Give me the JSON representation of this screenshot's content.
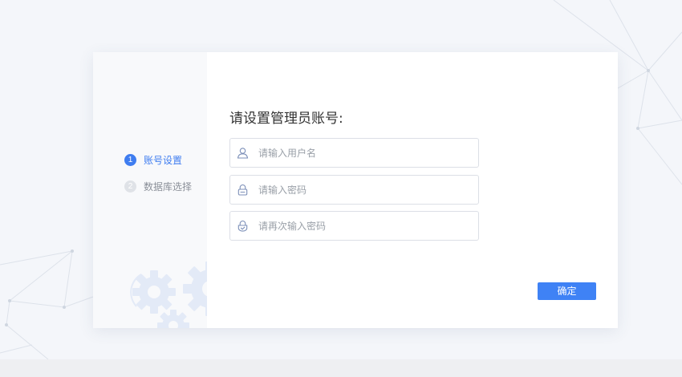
{
  "sidebar": {
    "steps": [
      {
        "number": "1",
        "label": "账号设置",
        "state": "active"
      },
      {
        "number": "2",
        "label": "数据库选择",
        "state": "pending"
      }
    ],
    "decoration_icon": "gears-icon"
  },
  "form": {
    "title": "请设置管理员账号:",
    "fields": [
      {
        "icon": "user-icon",
        "placeholder": "请输入用户名",
        "value": ""
      },
      {
        "icon": "lock-icon",
        "placeholder": "请输入密码",
        "value": ""
      },
      {
        "icon": "shield-lock-icon",
        "placeholder": "请再次输入密码",
        "value": ""
      }
    ],
    "confirm_label": "确定"
  },
  "colors": {
    "accent": "#3f82f5",
    "step_inactive": "#dfe2e7",
    "background": "#f4f6fa"
  }
}
